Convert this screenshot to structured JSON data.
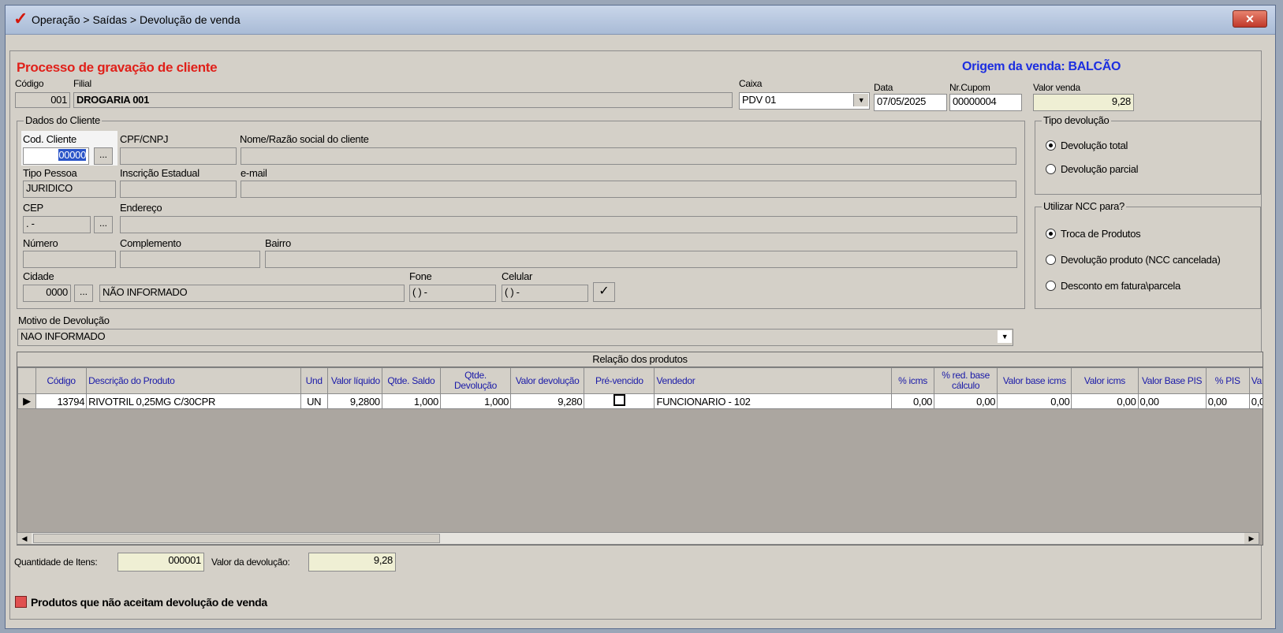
{
  "window": {
    "title": "Operação > Saídas > Devolução de venda",
    "close_label": "✕"
  },
  "header": {
    "process_title": "Processo de gravação de cliente",
    "origin": "Origem da venda: BALCÃO",
    "codigo_label": "Código",
    "codigo_value": "001",
    "filial_label": "Filial",
    "filial_value": "DROGARIA 001",
    "caixa_label": "Caixa",
    "caixa_value": "PDV 01",
    "data_label": "Data",
    "data_value": "07/05/2025",
    "cupom_label": "Nr.Cupom",
    "cupom_value": "00000004",
    "valor_venda_label": "Valor venda",
    "valor_venda_value": "9,28"
  },
  "cliente": {
    "group_title": "Dados do Cliente",
    "cod_label": "Cod. Cliente",
    "cod_value": "00000",
    "cpf_label": "CPF/CNPJ",
    "cpf_value": "",
    "nome_label": "Nome/Razão social do cliente",
    "nome_value": "",
    "tipo_label": "Tipo Pessoa",
    "tipo_value": "JURIDICO",
    "ie_label": "Inscrição Estadual",
    "ie_value": "",
    "email_label": "e-mail",
    "email_value": "",
    "cep_label": "CEP",
    "cep_value": " .  -",
    "endereco_label": "Endereço",
    "endereco_value": "",
    "numero_label": "Número",
    "numero_value": "",
    "complemento_label": "Complemento",
    "complemento_value": "",
    "bairro_label": "Bairro",
    "bairro_value": "",
    "cidade_label": "Cidade",
    "cidade_code": "0000",
    "cidade_value": "NÃO INFORMADO",
    "fone_label": "Fone",
    "fone_value": "( )    -",
    "celular_label": "Celular",
    "celular_value": "( )    -",
    "dots": "..."
  },
  "tipo_devolucao": {
    "title": "Tipo devolução",
    "options": [
      "Devolução total",
      "Devolução parcial"
    ],
    "selected": 0
  },
  "ncc": {
    "title": "Utilizar NCC para?",
    "options": [
      "Troca de Produtos",
      "Devolução produto (NCC cancelada)",
      "Desconto em fatura\\parcela"
    ],
    "selected": 0
  },
  "motivo": {
    "label": "Motivo de Devolução",
    "value": "NAO INFORMADO"
  },
  "produtos": {
    "title": "Relação dos produtos",
    "columns": [
      "Código",
      "Descrição do Produto",
      "Und",
      "Valor líquido",
      "Qtde. Saldo",
      "Qtde. Devolução",
      "Valor devolução",
      "Pré-vencido",
      "Vendedor",
      "% icms",
      "% red. base cálculo",
      "Valor base icms",
      "Valor icms",
      "Valor Base PIS",
      "% PIS",
      "Va"
    ],
    "rows": [
      [
        "13794",
        "RIVOTRIL 0,25MG C/30CPR",
        "UN",
        "9,2800",
        "1,000",
        "1,000",
        "9,280",
        "",
        "FUNCIONARIO - 102",
        "0,00",
        "0,00",
        "0,00",
        "0,00",
        "0,00",
        "0,00",
        "0,0"
      ]
    ]
  },
  "footer": {
    "qtd_label": "Quantidade de Itens:",
    "qtd_value": "000001",
    "valor_label": "Valor da devolução:",
    "valor_value": "9,28",
    "legend_label": "Produtos que não aceitam devolução de venda",
    "legend_color": "#e05050"
  }
}
